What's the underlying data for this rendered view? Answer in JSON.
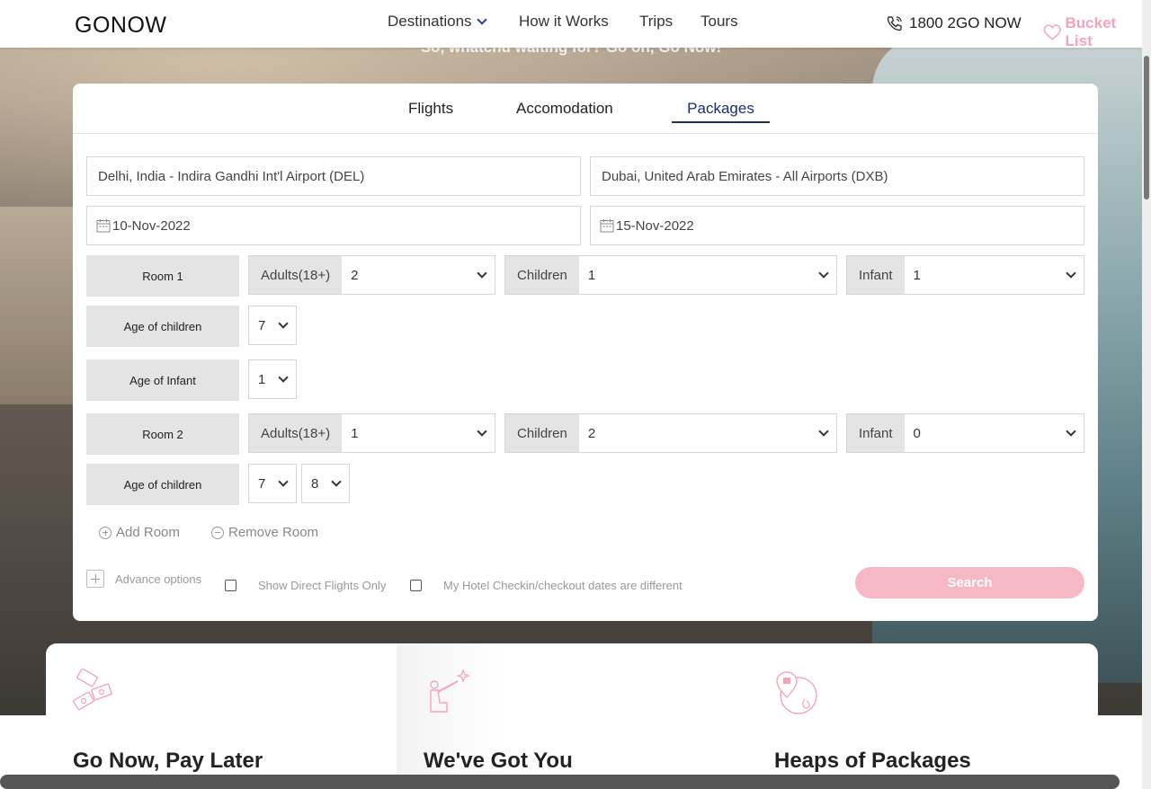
{
  "navbar": {
    "logo": "GONOW",
    "links": [
      "Destinations",
      "How it Works",
      "Trips",
      "Tours"
    ],
    "phone": "1800 2GO NOW",
    "bucket_list": "Bucket List"
  },
  "hero": {
    "tagline": "So, whatchu waiting for? Go on, Go Now!"
  },
  "tabs": [
    "Flights",
    "Accomodation",
    "Packages"
  ],
  "search": {
    "from": "Delhi, India - Indira Gandhi Int'l Airport (DEL)",
    "to": "Dubai, United Arab Emirates - All Airports (DXB)",
    "depart": "10-Nov-2022",
    "return": "15-Nov-2022",
    "rooms": [
      {
        "label": "Room 1",
        "adults_label": "Adults(18+)",
        "adults": "2",
        "children_label": "Children",
        "children": "1",
        "infant_label": "Infant",
        "infant": "1",
        "age_children_label": "Age of children",
        "child_ages": [
          "7"
        ],
        "age_infant_label": "Age of Infant",
        "infant_ages": [
          "1"
        ]
      },
      {
        "label": "Room 2",
        "adults_label": "Adults(18+)",
        "adults": "1",
        "children_label": "Children",
        "children": "2",
        "infant_label": "Infant",
        "infant": "0",
        "age_children_label": "Age of children",
        "child_ages": [
          "7",
          "8"
        ]
      }
    ],
    "add_room": "Add Room",
    "remove_room": "Remove Room",
    "advance_options": "Advance options",
    "direct_flights": "Show Direct Flights Only",
    "hotel_dates": "My Hotel Checkin/checkout dates are different",
    "search_button": "Search"
  },
  "features": [
    "Go Now, Pay Later",
    "We've Got You",
    "Heaps of Packages"
  ],
  "colors": {
    "accent": "#1e2c6e",
    "pink": "#f7b8c6"
  }
}
